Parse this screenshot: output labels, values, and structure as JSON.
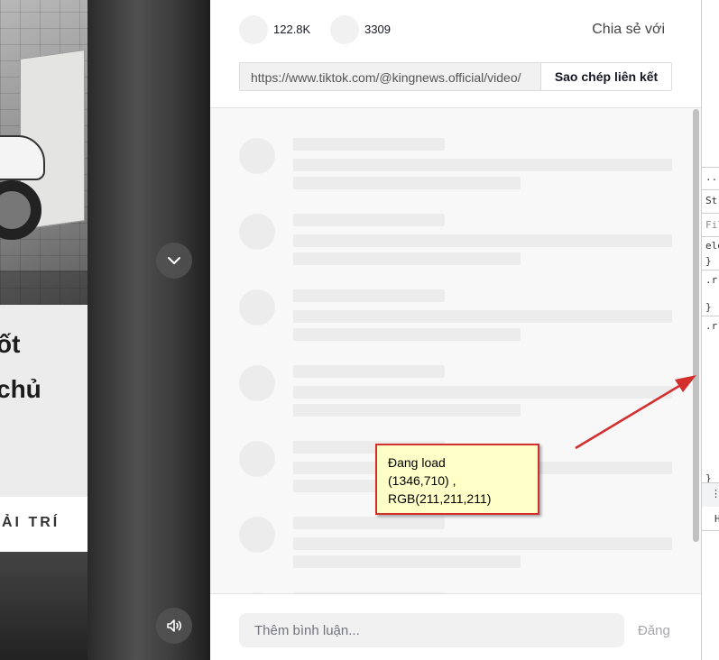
{
  "video": {
    "card_line1": "ốt",
    "card_line2": "chủ",
    "card_footer": "ẢI TRÍ"
  },
  "stats": {
    "likes": "122.8K",
    "comments": "3309"
  },
  "share": {
    "label": "Chia sẻ với",
    "link_url": "https://www.tiktok.com/@kingnews.official/video/",
    "copy_label": "Sao chép liên kết"
  },
  "comment_bar": {
    "placeholder": "Thêm bình luận...",
    "post_label": "Đăng"
  },
  "devtools": {
    "lines": [
      "...",
      "St",
      "Fil",
      "ele",
      "}",
      ".r:",
      "}",
      ".r:",
      "}",
      "⋮",
      "H"
    ]
  },
  "annotation": {
    "line1": "Đang load",
    "line2": "(1346,710) ,",
    "line3": "RGB(211,211,211)",
    "color": "#d32f2f"
  }
}
